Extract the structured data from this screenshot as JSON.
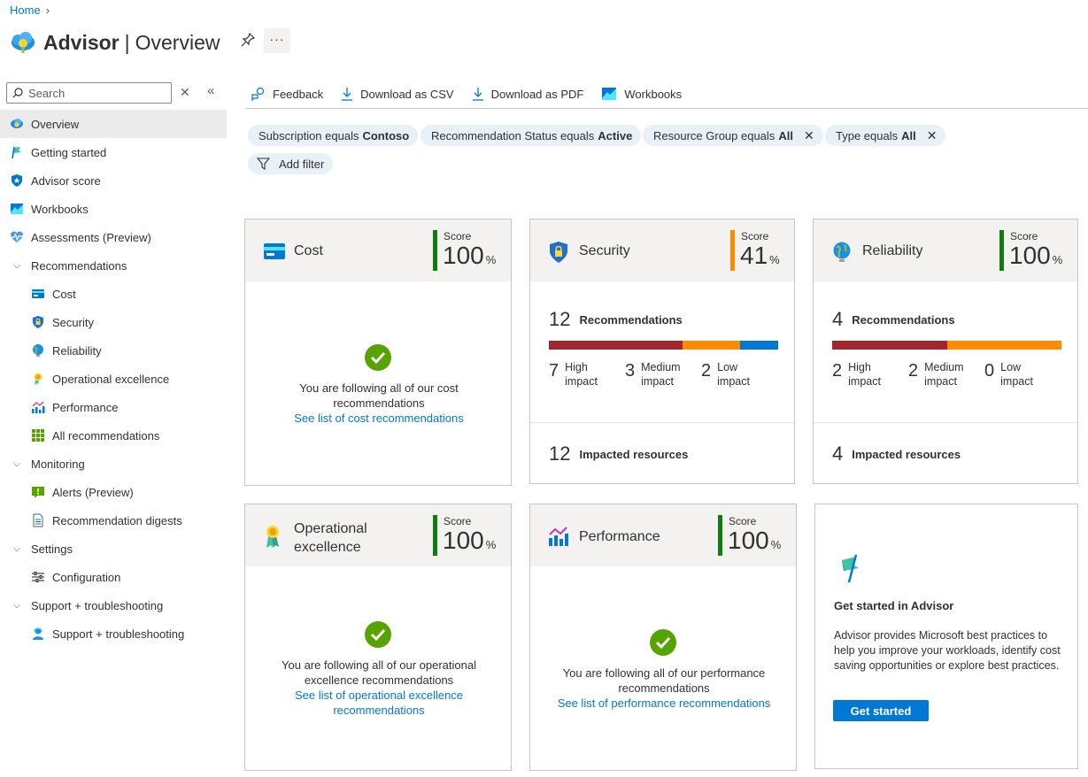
{
  "breadcrumb": {
    "home": "Home"
  },
  "header": {
    "title": "Advisor",
    "separator": "|",
    "subtitle": "Overview",
    "more": "···"
  },
  "sidebar": {
    "search_placeholder": "Search",
    "clear": "✕",
    "collapse": "«",
    "items": [
      {
        "label": "Overview",
        "icon": "advisor-icon"
      },
      {
        "label": "Getting started",
        "icon": "flag-icon"
      },
      {
        "label": "Advisor score",
        "icon": "shield-star-icon"
      },
      {
        "label": "Workbooks",
        "icon": "workbook-icon"
      },
      {
        "label": "Assessments (Preview)",
        "icon": "heartbeat-icon"
      },
      {
        "label": "Recommendations",
        "icon": "chevron-down-icon"
      },
      {
        "label": "Cost",
        "icon": "cost-icon"
      },
      {
        "label": "Security",
        "icon": "security-icon"
      },
      {
        "label": "Reliability",
        "icon": "globe-icon"
      },
      {
        "label": "Operational excellence",
        "icon": "ribbon-icon"
      },
      {
        "label": "Performance",
        "icon": "performance-icon"
      },
      {
        "label": "All recommendations",
        "icon": "grid-icon"
      },
      {
        "label": "Monitoring",
        "icon": "chevron-down-icon"
      },
      {
        "label": "Alerts (Preview)",
        "icon": "alert-icon"
      },
      {
        "label": "Recommendation digests",
        "icon": "document-icon"
      },
      {
        "label": "Settings",
        "icon": "chevron-down-icon"
      },
      {
        "label": "Configuration",
        "icon": "sliders-icon"
      },
      {
        "label": "Support + troubleshooting",
        "icon": "chevron-down-icon"
      },
      {
        "label": "Support + troubleshooting",
        "icon": "support-icon"
      }
    ]
  },
  "toolbar": {
    "feedback": "Feedback",
    "csv": "Download as CSV",
    "pdf": "Download as PDF",
    "workbooks": "Workbooks"
  },
  "filters": {
    "subscription": {
      "prefix": "Subscription equals",
      "value": "Contoso"
    },
    "status": {
      "prefix": "Recommendation Status equals",
      "value": "Active"
    },
    "resource_group": {
      "prefix": "Resource Group equals",
      "value": "All",
      "remove": "✕"
    },
    "type": {
      "prefix": "Type equals",
      "value": "All",
      "remove": "✕"
    },
    "add": "Add filter"
  },
  "cards": {
    "score_label": "Score",
    "pct": "%",
    "cost": {
      "title": "Cost",
      "score": "100",
      "score_fraction": 1.0,
      "msg": "You are following all of our cost recommendations",
      "link": "See list of cost recommendations"
    },
    "security": {
      "title": "Security",
      "score": "41",
      "score_fraction": 0.41,
      "rec_count": "12",
      "rec_label": "Recommendations",
      "high_n": "7",
      "high_l": "High impact",
      "med_n": "3",
      "med_l": "Medium impact",
      "low_n": "2",
      "low_l": "Low impact",
      "resources_n": "12",
      "resources_l": "Impacted resources"
    },
    "reliability": {
      "title": "Reliability",
      "score": "100",
      "score_fraction": 1.0,
      "rec_count": "4",
      "rec_label": "Recommendations",
      "high_n": "2",
      "high_l": "High impact",
      "med_n": "2",
      "med_l": "Medium impact",
      "low_n": "0",
      "low_l": "Low impact",
      "resources_n": "4",
      "resources_l": "Impacted resources"
    },
    "opex": {
      "title_line1": "Operational",
      "title_line2": "excellence",
      "score": "100",
      "score_fraction": 1.0,
      "msg": "You are following all of our operational excellence recommendations",
      "link": "See list of operational excellence recommendations"
    },
    "performance": {
      "title": "Performance",
      "score": "100",
      "score_fraction": 1.0,
      "msg": "You are following all of our performance recommendations",
      "link": "See list of performance recommendations"
    },
    "get_started": {
      "title": "Get started in Advisor",
      "body": "Advisor provides Microsoft best practices to help you improve your workloads, identify cost saving opportunities or explore best practices.",
      "button": "Get started"
    }
  },
  "colors": {
    "accent": "#0078d4",
    "score_green": "#107c10",
    "score_orange": "#ff8c00",
    "high": "#a4262c",
    "medium": "#ff8c00",
    "low": "#0078d4",
    "check": "#57a300"
  }
}
